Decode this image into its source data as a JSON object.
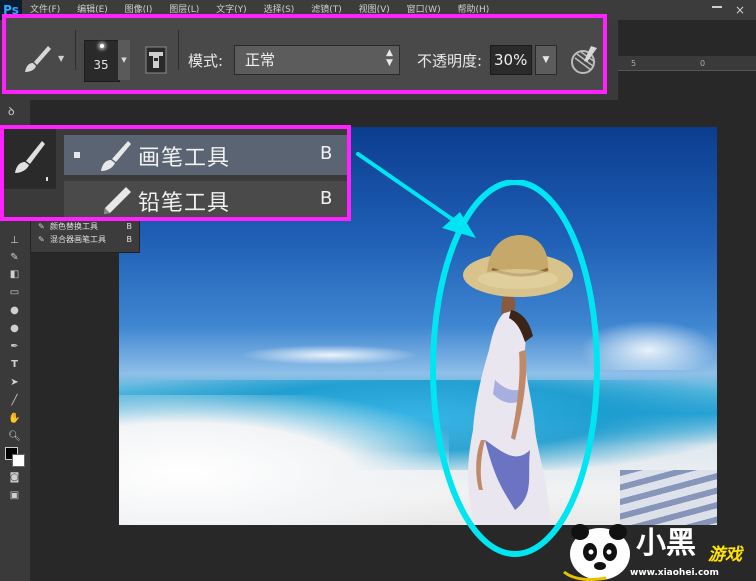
{
  "app": {
    "logo": "Ps",
    "menus": [
      "文件(F)",
      "编辑(E)",
      "图像(I)",
      "图层(L)",
      "文字(Y)",
      "选择(S)",
      "滤镜(T)",
      "视图(V)",
      "窗口(W)",
      "帮助(H)"
    ],
    "close_glyph": "×"
  },
  "options_bar": {
    "brush_size": "35",
    "mode_label": "模式:",
    "mode_value": "正常",
    "opacity_label": "不透明度:",
    "opacity_value": "30%"
  },
  "ruler": {
    "tick_a": "5",
    "tick_b": "0"
  },
  "tool_flyout": {
    "items": [
      {
        "label": "画笔工具",
        "shortcut": "B",
        "selected": true
      },
      {
        "label": "铅笔工具",
        "shortcut": "B",
        "selected": false
      },
      {
        "label": "颜色替换工具",
        "shortcut": "B",
        "selected": false
      },
      {
        "label": "混合器画笔工具",
        "shortcut": "B",
        "selected": false
      }
    ]
  },
  "watermark": {
    "title": "小黑",
    "subtitle": "游戏",
    "url": "www.xiaohei.com"
  },
  "colors": {
    "highlight_frame": "#ff22ff",
    "annotation": "#00e5f2",
    "selected_row": "#5a6473"
  }
}
